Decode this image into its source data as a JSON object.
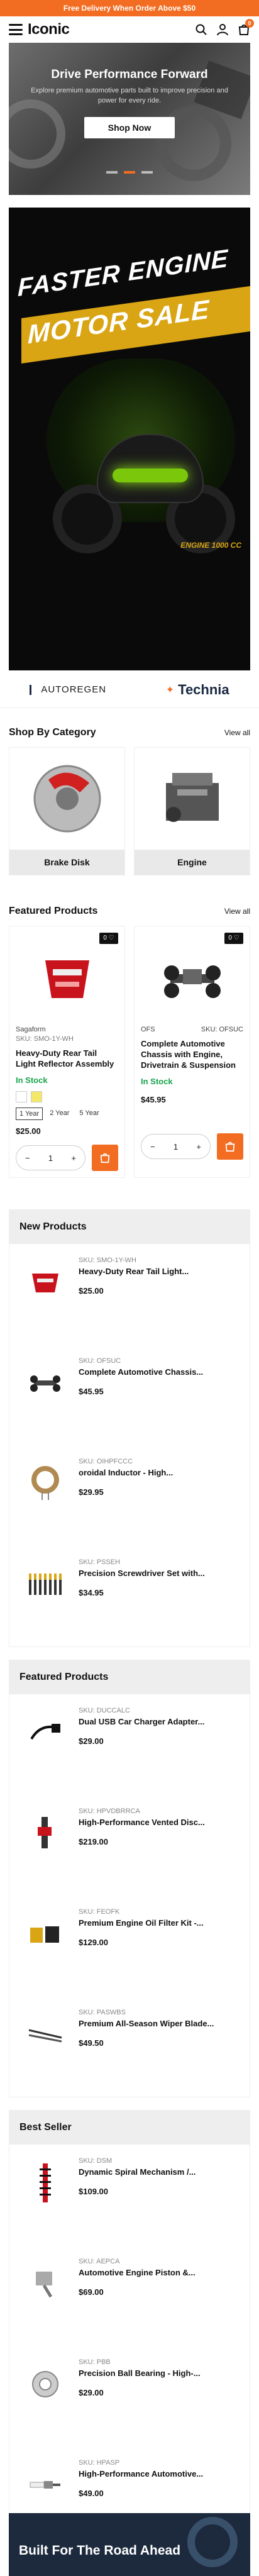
{
  "promo": "Free Delivery When Order Above $50",
  "header": {
    "logo": "Iconic",
    "cart_count": "0"
  },
  "hero": {
    "title": "Drive Performance Forward",
    "subtitle": "Explore premium automotive parts built to improve precision and power for every ride.",
    "button": "Shop Now"
  },
  "banner": {
    "line1": "FASTER ENGINE",
    "line2": "MOTOR SALE",
    "tag": "ENGINE 1000 CC"
  },
  "brands": [
    "AUTOREGEN",
    "Technia"
  ],
  "categories": {
    "title": "Shop By Category",
    "view_all": "View all",
    "items": [
      {
        "label": "Brake Disk"
      },
      {
        "label": "Engine"
      }
    ]
  },
  "featured": {
    "title": "Featured Products",
    "view_all": "View all",
    "items": [
      {
        "brand": "Sagaform",
        "sku": "SKU: SMO-1Y-WH",
        "name": "Heavy-Duty Rear Tail Light Reflector Assembly",
        "stock": "In Stock",
        "variants": [
          "1 Year",
          "2 Year",
          "5 Year"
        ],
        "price": "$25.00",
        "qty": "1",
        "wish": "0 ♡"
      },
      {
        "brand": "OFS",
        "sku": "SKU: OFSUC",
        "name": "Complete Automotive Chassis with Engine, Drivetrain & Suspension",
        "stock": "In Stock",
        "price": "$45.95",
        "qty": "1",
        "wish": "0 ♡"
      }
    ]
  },
  "new_products": {
    "title": "New Products",
    "items": [
      {
        "sku": "SKU: SMO-1Y-WH",
        "name": "Heavy-Duty Rear Tail Light...",
        "price": "$25.00"
      },
      {
        "sku": "SKU: OFSUC",
        "name": "Complete Automotive Chassis...",
        "price": "$45.95"
      },
      {
        "sku": "SKU: OIHPFCCC",
        "name": "oroidal Inductor - High...",
        "price": "$29.95"
      },
      {
        "sku": "SKU: PSSEH",
        "name": "Precision Screwdriver Set with...",
        "price": "$34.95"
      }
    ]
  },
  "featured_list": {
    "title": "Featured Products",
    "items": [
      {
        "sku": "SKU: DUCCALC",
        "name": "Dual USB Car Charger Adapter...",
        "price": "$29.00"
      },
      {
        "sku": "SKU: HPVDBRRCA",
        "name": "High-Performance Vented Disc...",
        "price": "$219.00"
      },
      {
        "sku": "SKU: FEOFK",
        "name": "Premium Engine Oil Filter Kit -...",
        "price": "$129.00"
      },
      {
        "sku": "SKU: PASWBS",
        "name": "Premium All-Season Wiper Blade...",
        "price": "$49.50"
      }
    ]
  },
  "best_seller": {
    "title": "Best Seller",
    "items": [
      {
        "sku": "SKU: DSM",
        "name": "Dynamic Spiral Mechanism /...",
        "price": "$109.00"
      },
      {
        "sku": "SKU: AEPCA",
        "name": "Automotive Engine Piston &...",
        "price": "$69.00"
      },
      {
        "sku": "SKU: PBB",
        "name": "Precision Ball Bearing - High-...",
        "price": "$29.00"
      },
      {
        "sku": "SKU: HPASP",
        "name": "High-Performance Automotive...",
        "price": "$49.00"
      }
    ]
  },
  "footer_banner": {
    "title": "Built For The Road Ahead"
  },
  "colors": {
    "accent": "#f26d21",
    "in_stock": "#18a34a",
    "banner_gold": "#d9a514"
  }
}
